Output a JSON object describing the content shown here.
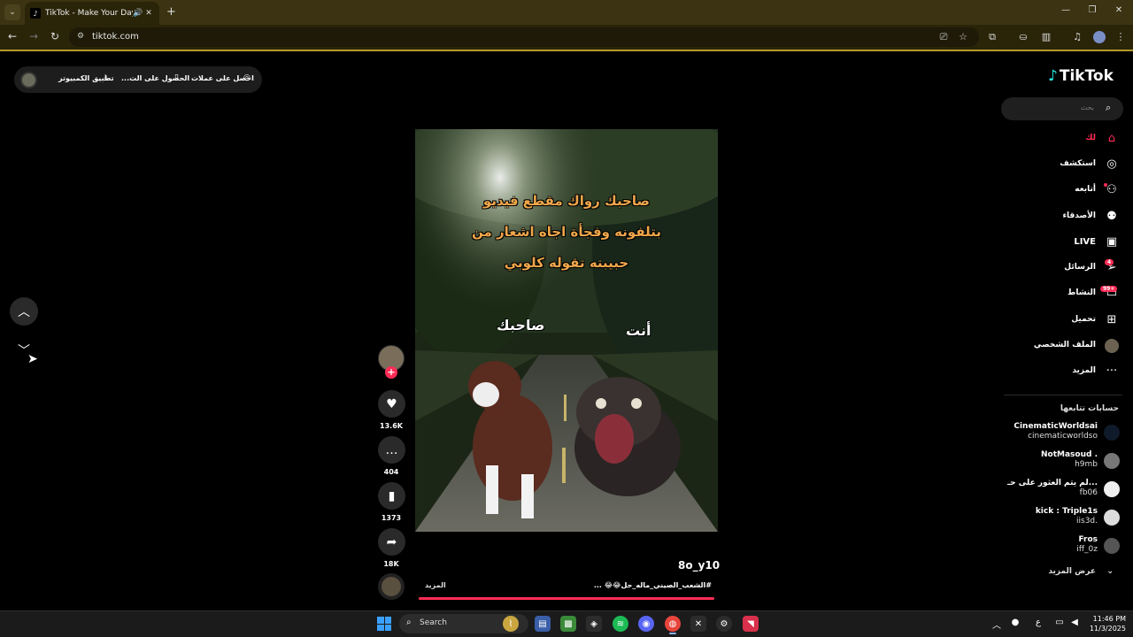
{
  "browser": {
    "tab_title": "TikTok - Make Your Day",
    "tab_favicon": "tiktok-icon",
    "url": "tiktok.com",
    "accent": "#b39a2a"
  },
  "topbar": {
    "item1": "احصل على عملات",
    "item2": "الحصول على الت...",
    "item3": "تطبيق الكمبيوتر"
  },
  "video": {
    "line1": "صاحبك رواك مقطع فيديو",
    "line2": "بتلفونه وفجأة اجاه اشعار من",
    "line3": "حبيبته تقوله كلوبي",
    "label_friend": "صاحبك",
    "label_you": "أنت",
    "author": "8o_y10",
    "caption": "#الشعب_الصيني_ماله_حل😂😂 ...",
    "more": "المزيد",
    "progress": 1.0
  },
  "actions": {
    "likes": "13.6K",
    "comments": "404",
    "saves": "1373",
    "shares": "18K"
  },
  "sidebar": {
    "logo": "TikTok",
    "search_placeholder": "بحث",
    "nav": [
      {
        "label": "لك",
        "icon": "home-icon",
        "active": true
      },
      {
        "label": "استكشف",
        "icon": "compass-icon"
      },
      {
        "label": "أتابعه",
        "icon": "following-icon"
      },
      {
        "label": "الأصدقاء",
        "icon": "friends-icon"
      },
      {
        "label": "LIVE",
        "icon": "live-icon"
      },
      {
        "label": "الرسائل",
        "icon": "messages-icon",
        "badge": "4"
      },
      {
        "label": "النشاط",
        "icon": "activity-icon",
        "badge": "99+"
      },
      {
        "label": "تحميل",
        "icon": "upload-icon"
      },
      {
        "label": "الملف الشخصي",
        "icon": "profile-avatar"
      },
      {
        "label": "المزيد",
        "icon": "more-icon"
      }
    ],
    "following_title": "حسابات تتابعها",
    "accounts": [
      {
        "name": "CinematicWorldsai",
        "user": "cinematicworldso"
      },
      {
        "name": "NotMasoud .",
        "user": "h9mb"
      },
      {
        "name": "لم يتم العثور على حـ...",
        "user": "fb06"
      },
      {
        "name": "kick : Triple1s",
        "user": "iis3d."
      },
      {
        "name": "Fros",
        "user": "iff_0z"
      }
    ],
    "see_more": "عرض المزيد"
  },
  "taskbar": {
    "search_label": "Search",
    "time": "11:46 PM",
    "date": "11/3/2025",
    "lang": "ع"
  }
}
